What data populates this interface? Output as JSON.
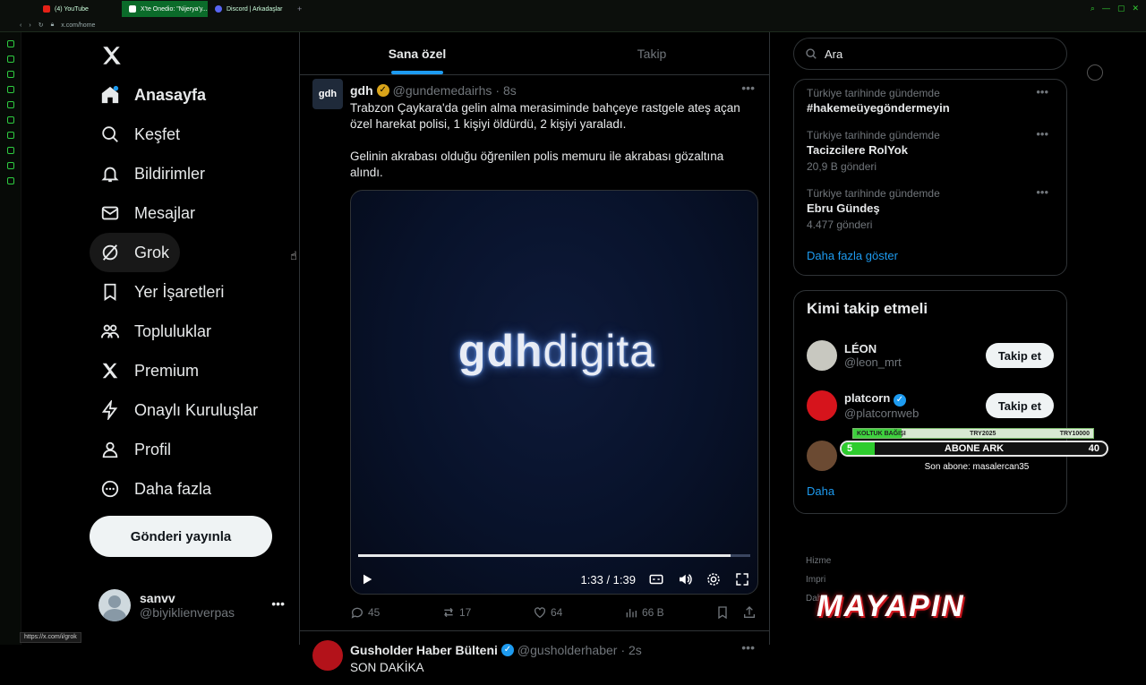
{
  "browser": {
    "tabs": [
      {
        "label": "(4) YouTube",
        "color": "#e62117"
      },
      {
        "label": "X'te Onedio: \"Nijerya'y...",
        "color": "#ffffff"
      },
      {
        "label": "Discord | Arkadaşlar",
        "color": "#5865f2"
      }
    ],
    "url": "x.com/home",
    "status_url": "https://x.com/i/grok"
  },
  "nav": {
    "items": [
      {
        "label": "Anasayfa",
        "icon": "home-icon"
      },
      {
        "label": "Keşfet",
        "icon": "search-icon"
      },
      {
        "label": "Bildirimler",
        "icon": "bell-icon"
      },
      {
        "label": "Mesajlar",
        "icon": "mail-icon"
      },
      {
        "label": "Grok",
        "icon": "grok-icon"
      },
      {
        "label": "Yer İşaretleri",
        "icon": "bookmark-icon"
      },
      {
        "label": "Topluluklar",
        "icon": "communities-icon"
      },
      {
        "label": "Premium",
        "icon": "x-logo-icon"
      },
      {
        "label": "Onaylı Kuruluşlar",
        "icon": "lightning-icon"
      },
      {
        "label": "Profil",
        "icon": "person-icon"
      },
      {
        "label": "Daha fazla",
        "icon": "more-circle-icon"
      }
    ],
    "post_button": "Gönderi yayınla",
    "profile": {
      "name": "sanvv",
      "handle": "@biyiklienverpas"
    }
  },
  "feed": {
    "tabs": [
      "Sana özel",
      "Takip"
    ],
    "tweet": {
      "avatar_text": "gdh",
      "name": "gdh",
      "handle": "@gundemedairhs",
      "time": "· 8s",
      "text1": "Trabzon Çaykara'da gelin alma merasiminde bahçeye rastgele ateş açan özel harekat polisi, 1 kişiyi öldürdü, 2 kişiyi yaraladı.",
      "text2": "Gelinin akrabası olduğu öğrenilen polis memuru ile akrabası gözaltına alındı.",
      "video": {
        "logo_a": "gdh",
        "logo_b": "digita",
        "time": "1:33 / 1:39",
        "progress": 0.95
      },
      "stats": {
        "replies": "45",
        "reposts": "17",
        "likes": "64",
        "views": "66 B"
      }
    },
    "tweet2": {
      "name": "Gusholder Haber Bülteni",
      "handle": "@gusholderhaber",
      "time": "· 2s",
      "text": "SON DAKİKA"
    }
  },
  "sidebar": {
    "search_value": "Ara",
    "trends": [
      {
        "category": "Türkiye tarihinde gündemde",
        "name": "#hakemeüyegöndermeyin",
        "count": ""
      },
      {
        "category": "Türkiye tarihinde gündemde",
        "name": "Tacizcilere RolYok",
        "count": "20,9 B gönderi"
      },
      {
        "category": "Türkiye tarihinde gündemde",
        "name": "Ebru Gündeş",
        "count": "4.477 gönderi"
      }
    ],
    "show_more": "Daha fazla göster",
    "who_to_follow": {
      "title": "Kimi takip etmeli",
      "users": [
        {
          "name": "LÉON",
          "handle": "@leon_mrt",
          "button": "Takip et",
          "color": "#c8c8c0"
        },
        {
          "name": "platcorn",
          "handle": "@platcornweb",
          "button": "Takip et",
          "color": "#d6141c"
        }
      ],
      "partial": "Daha"
    },
    "footer": [
      "Hizme",
      "Impri",
      "Daha"
    ]
  },
  "overlay": {
    "goal_label": "KOLTUK BAĞIŞI",
    "goal_mid": "TRY2025",
    "goal_max": "TRY10000",
    "goal_progress": 0.2,
    "sub_current": "5",
    "sub_label": "ABONE ARK",
    "sub_target": "40",
    "sub_progress": 0.125,
    "last_sub": "Son abone: masalercan35",
    "brand": "MAYAPIN"
  }
}
